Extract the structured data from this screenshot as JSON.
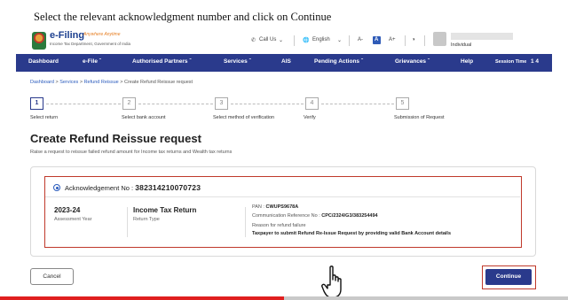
{
  "caption": "Select the relevant acknowledgment number and click on Continue",
  "header": {
    "logo_title": "e-Filing",
    "logo_tagline": "Anywhere Anytime",
    "logo_subtitle": "Income Tax Department, Government of India",
    "call_us": "Call Us",
    "language": "English",
    "font_dec": "A-",
    "font_normal": "A",
    "font_inc": "A+",
    "user_type": "Individual"
  },
  "nav": {
    "dashboard": "Dashboard",
    "efile": "e-File",
    "authorised_partners": "Authorised Partners",
    "services": "Services",
    "ais": "AIS",
    "pending_actions": "Pending Actions",
    "grievances": "Grievances",
    "help": "Help",
    "session_time_label": "Session Time",
    "session_time_value": "1 4"
  },
  "breadcrumb": {
    "dashboard": "Dashboard",
    "services": "Services",
    "refund_reissue": "Refund Reissue",
    "current": "Create Refund Reissue request",
    "separator": ">"
  },
  "stepper": {
    "steps": [
      {
        "num": "1",
        "label": "Select return"
      },
      {
        "num": "2",
        "label": "Select bank account"
      },
      {
        "num": "3",
        "label": "Select method of verification"
      },
      {
        "num": "4",
        "label": "Verify"
      },
      {
        "num": "5",
        "label": "Submission of Request"
      }
    ],
    "active_step": 1
  },
  "page": {
    "title": "Create Refund Reissue request",
    "description": "Raise a request to reissue failed refund amount for Income tax returns and Wealth tax returns"
  },
  "card": {
    "ack_label": "Acknowledgement No :",
    "ack_value": "382314210070723",
    "assessment_year": "2023-24",
    "assessment_year_label": "Assessment Year",
    "return_type": "Income Tax Return",
    "return_type_label": "Return Type",
    "pan_label": "PAN :",
    "pan_value": "CWUPS9678A",
    "comm_ref_label": "Communication Reference No :",
    "comm_ref_value": "CPC/2324/G3/383254494",
    "reason_label": "Reason for refund failure",
    "reason_value": "Taxpayer to submit Refund Re-Issue Request by providing valid Bank Account details"
  },
  "buttons": {
    "cancel": "Cancel",
    "continue": "Continue"
  },
  "video_progress": 0.5,
  "colors": {
    "nav_bg": "#2a3a8c",
    "highlight": "#c0392b",
    "progress": "#e01f1f"
  }
}
